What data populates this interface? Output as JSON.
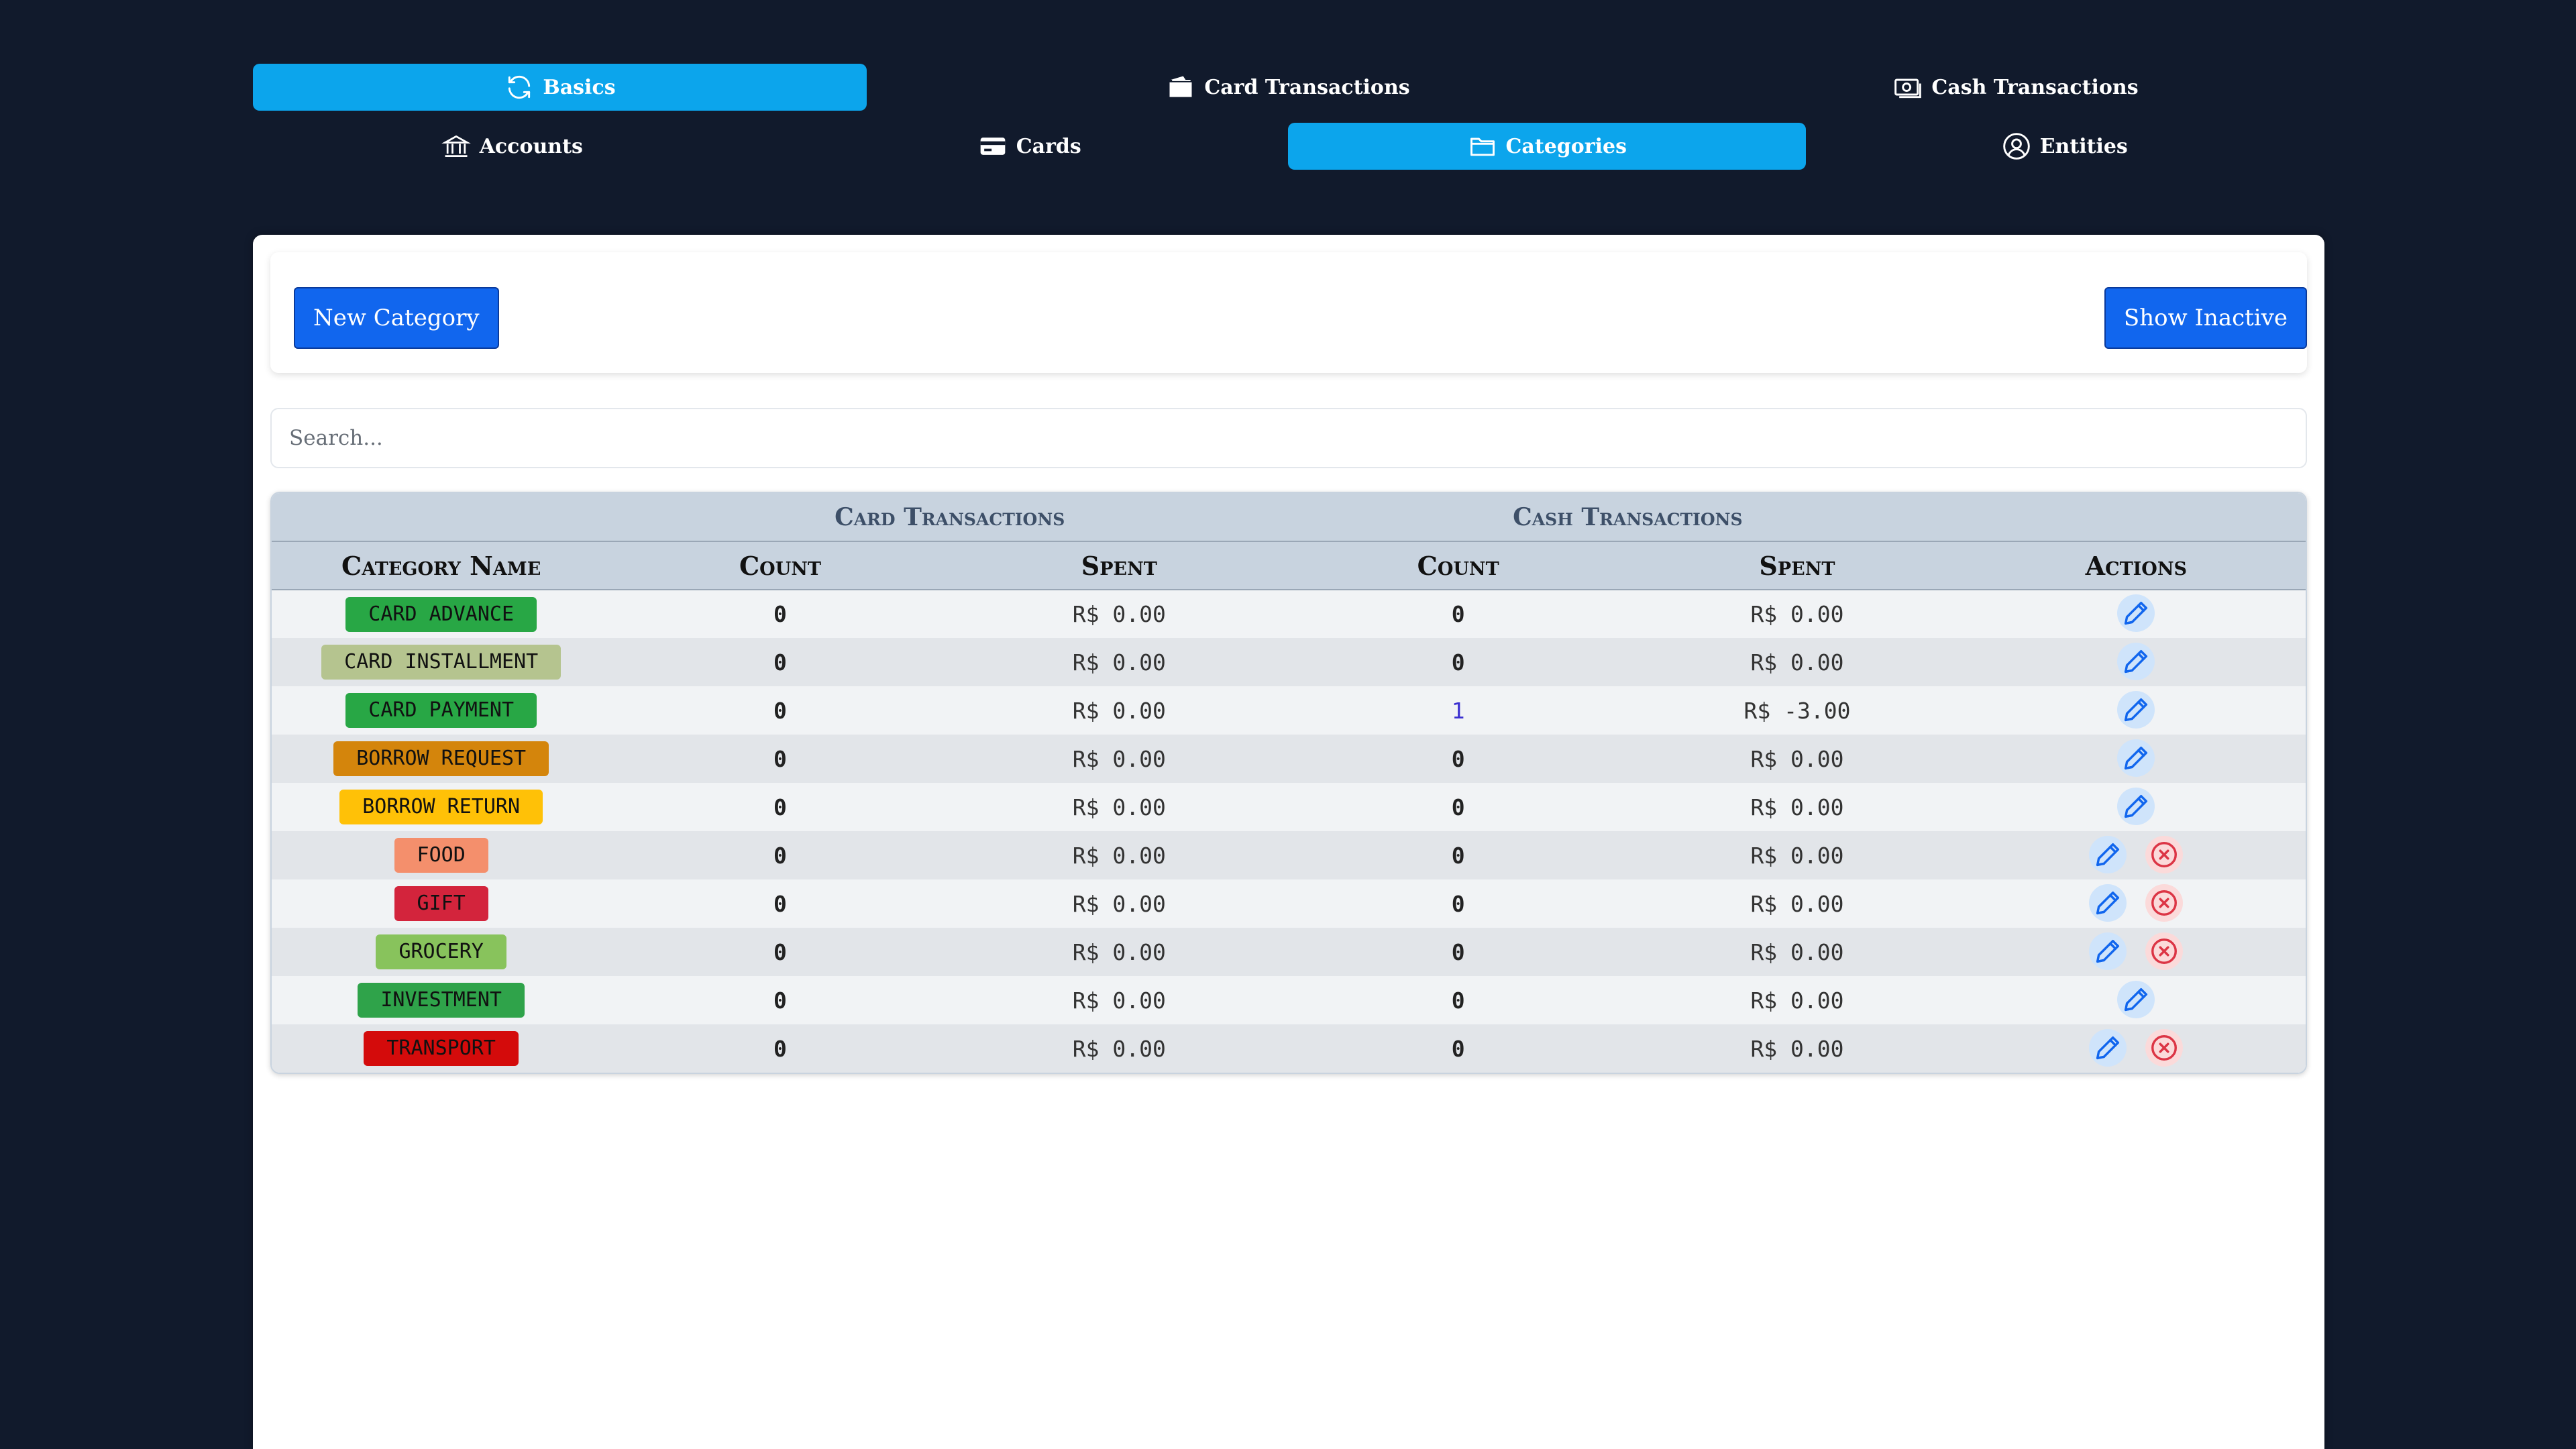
{
  "nav": {
    "row1": [
      {
        "label": "Basics",
        "icon": "refresh-icon",
        "active": true
      },
      {
        "label": "Card Transactions",
        "icon": "wallet-icon",
        "active": false
      },
      {
        "label": "Cash Transactions",
        "icon": "cash-icon",
        "active": false
      }
    ],
    "row2": [
      {
        "label": "Accounts",
        "icon": "bank-icon",
        "active": false
      },
      {
        "label": "Cards",
        "icon": "credit-card-icon",
        "active": false
      },
      {
        "label": "Categories",
        "icon": "folder-icon",
        "active": true
      },
      {
        "label": "Entities",
        "icon": "user-circle-icon",
        "active": false
      }
    ]
  },
  "toolbar": {
    "new_label": "New Category",
    "inactive_label": "Show Inactive"
  },
  "search": {
    "placeholder": "Search...",
    "value": ""
  },
  "table": {
    "group_headers": {
      "card": "Card Transactions",
      "cash": "Cash Transactions"
    },
    "columns": {
      "name": "Category Name",
      "card_count": "Count",
      "card_spent": "Spent",
      "cash_count": "Count",
      "cash_spent": "Spent",
      "actions": "Actions"
    },
    "rows": [
      {
        "name": "CARD ADVANCE",
        "color": "#28a745",
        "card_count": "0",
        "card_spent": "R$ 0.00",
        "cash_count": "0",
        "cash_spent": "R$ 0.00",
        "deletable": false
      },
      {
        "name": "CARD INSTALLMENT",
        "color": "#b5c48f",
        "card_count": "0",
        "card_spent": "R$ 0.00",
        "cash_count": "0",
        "cash_spent": "R$ 0.00",
        "deletable": false
      },
      {
        "name": "CARD PAYMENT",
        "color": "#28a745",
        "card_count": "0",
        "card_spent": "R$ 0.00",
        "cash_count": "1",
        "cash_spent": "R$ -3.00",
        "deletable": false
      },
      {
        "name": "BORROW REQUEST",
        "color": "#d4850c",
        "card_count": "0",
        "card_spent": "R$ 0.00",
        "cash_count": "0",
        "cash_spent": "R$ 0.00",
        "deletable": false
      },
      {
        "name": "BORROW RETURN",
        "color": "#ffc107",
        "card_count": "0",
        "card_spent": "R$ 0.00",
        "cash_count": "0",
        "cash_spent": "R$ 0.00",
        "deletable": false
      },
      {
        "name": "FOOD",
        "color": "#f48f6c",
        "card_count": "0",
        "card_spent": "R$ 0.00",
        "cash_count": "0",
        "cash_spent": "R$ 0.00",
        "deletable": true
      },
      {
        "name": "GIFT",
        "color": "#d3243c",
        "card_count": "0",
        "card_spent": "R$ 0.00",
        "cash_count": "0",
        "cash_spent": "R$ 0.00",
        "deletable": true
      },
      {
        "name": "GROCERY",
        "color": "#88c35c",
        "card_count": "0",
        "card_spent": "R$ 0.00",
        "cash_count": "0",
        "cash_spent": "R$ 0.00",
        "deletable": true
      },
      {
        "name": "INVESTMENT",
        "color": "#2fa34a",
        "card_count": "0",
        "card_spent": "R$ 0.00",
        "cash_count": "0",
        "cash_spent": "R$ 0.00",
        "deletable": false
      },
      {
        "name": "TRANSPORT",
        "color": "#d40b0b",
        "card_count": "0",
        "card_spent": "R$ 0.00",
        "cash_count": "0",
        "cash_spent": "R$ 0.00",
        "deletable": true
      }
    ]
  },
  "colors": {
    "background": "#111a2c",
    "active_tab": "#0ca5ec",
    "primary_button": "#1166ee",
    "header_bg": "#c8d3df",
    "edit_icon": "#1166ee",
    "delete_icon": "#dc3545"
  }
}
